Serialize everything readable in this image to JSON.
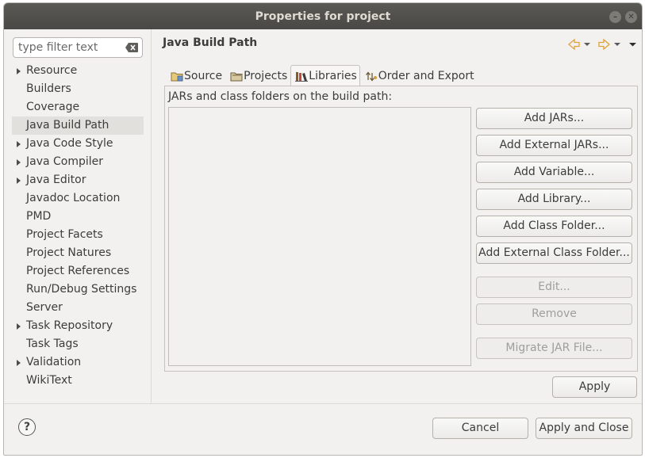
{
  "window": {
    "title": "Properties for project"
  },
  "filter": {
    "placeholder": "type filter text"
  },
  "tree": {
    "items": [
      {
        "label": "Resource",
        "expandable": true
      },
      {
        "label": "Builders",
        "expandable": false
      },
      {
        "label": "Coverage",
        "expandable": false
      },
      {
        "label": "Java Build Path",
        "expandable": false,
        "selected": true
      },
      {
        "label": "Java Code Style",
        "expandable": true
      },
      {
        "label": "Java Compiler",
        "expandable": true
      },
      {
        "label": "Java Editor",
        "expandable": true
      },
      {
        "label": "Javadoc Location",
        "expandable": false
      },
      {
        "label": "PMD",
        "expandable": false
      },
      {
        "label": "Project Facets",
        "expandable": false
      },
      {
        "label": "Project Natures",
        "expandable": false
      },
      {
        "label": "Project References",
        "expandable": false
      },
      {
        "label": "Run/Debug Settings",
        "expandable": false
      },
      {
        "label": "Server",
        "expandable": false
      },
      {
        "label": "Task Repository",
        "expandable": true
      },
      {
        "label": "Task Tags",
        "expandable": false
      },
      {
        "label": "Validation",
        "expandable": true
      },
      {
        "label": "WikiText",
        "expandable": false
      }
    ]
  },
  "page": {
    "title": "Java Build Path"
  },
  "tabs": [
    {
      "label": "Source",
      "icon": "source-folder-icon"
    },
    {
      "label": "Projects",
      "icon": "projects-folder-icon"
    },
    {
      "label": "Libraries",
      "icon": "libraries-icon",
      "active": true
    },
    {
      "label": "Order and Export",
      "icon": "order-export-icon"
    }
  ],
  "libraries": {
    "label": "JARs and class folders on the build path:",
    "buttons": {
      "add_jars": "Add JARs...",
      "add_external_jars": "Add External JARs...",
      "add_variable": "Add Variable...",
      "add_library": "Add Library...",
      "add_class_folder": "Add Class Folder...",
      "add_external_class_folder": "Add External Class Folder...",
      "edit": "Edit...",
      "remove": "Remove",
      "migrate_jar": "Migrate JAR File..."
    }
  },
  "actions": {
    "apply": "Apply",
    "cancel": "Cancel",
    "apply_and_close": "Apply and Close"
  },
  "colors": {
    "titlebar": "#4f4e4a",
    "window_bg": "#f2f1f0",
    "selection": "#e2e0dc",
    "disabled_text": "#a09e9a"
  }
}
